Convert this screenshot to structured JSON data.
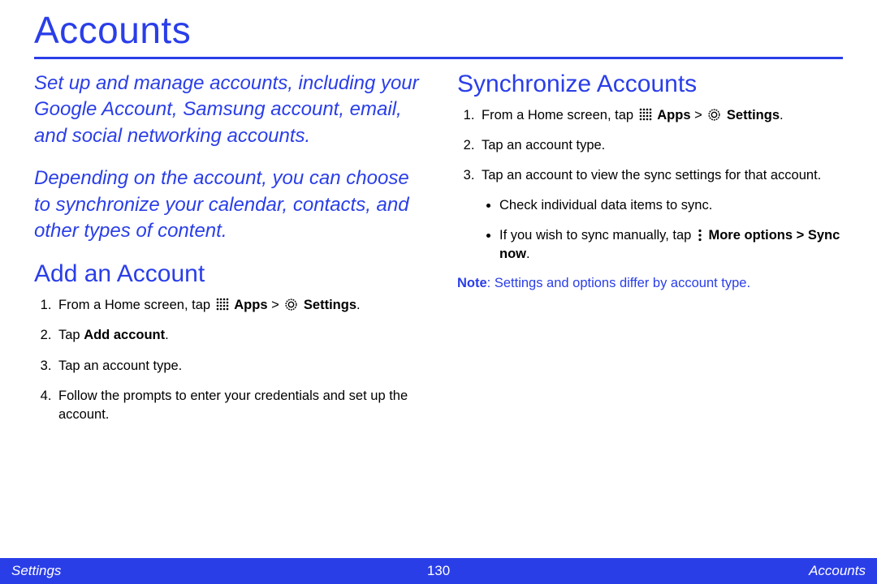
{
  "title": "Accounts",
  "intro": {
    "p1": "Set up and manage accounts, including your Google Account, Samsung account, email, and social networking accounts.",
    "p2": "Depending on the account, you can choose to synchronize your calendar, contacts, and other types of content."
  },
  "add": {
    "heading": "Add an Account",
    "step1_pre": "From a Home screen, tap ",
    "step1_apps": "Apps",
    "step1_gt": " > ",
    "step1_settings": "Settings",
    "step1_post": ".",
    "step2_pre": "Tap ",
    "step2_bold": "Add account",
    "step2_post": ".",
    "step3": "Tap an account type.",
    "step4": "Follow the prompts to enter your credentials and set up the account."
  },
  "sync": {
    "heading": "Synchronize Accounts",
    "step1_pre": "From a Home screen, tap ",
    "step1_apps": "Apps",
    "step1_gt": " > ",
    "step1_settings": "Settings",
    "step1_post": ".",
    "step2": "Tap an account type.",
    "step3": "Tap an account to view the sync settings for that account.",
    "sub1": "Check individual data items to sync.",
    "sub2_pre": "If you wish to sync manually, tap ",
    "sub2_more": "More options",
    "sub2_gt": " > ",
    "sub2_sync": "Sync now",
    "sub2_post": ".",
    "note_label": "Note",
    "note_text": ": Settings and options differ by account type."
  },
  "footer": {
    "left": "Settings",
    "page": "130",
    "right": "Accounts"
  }
}
